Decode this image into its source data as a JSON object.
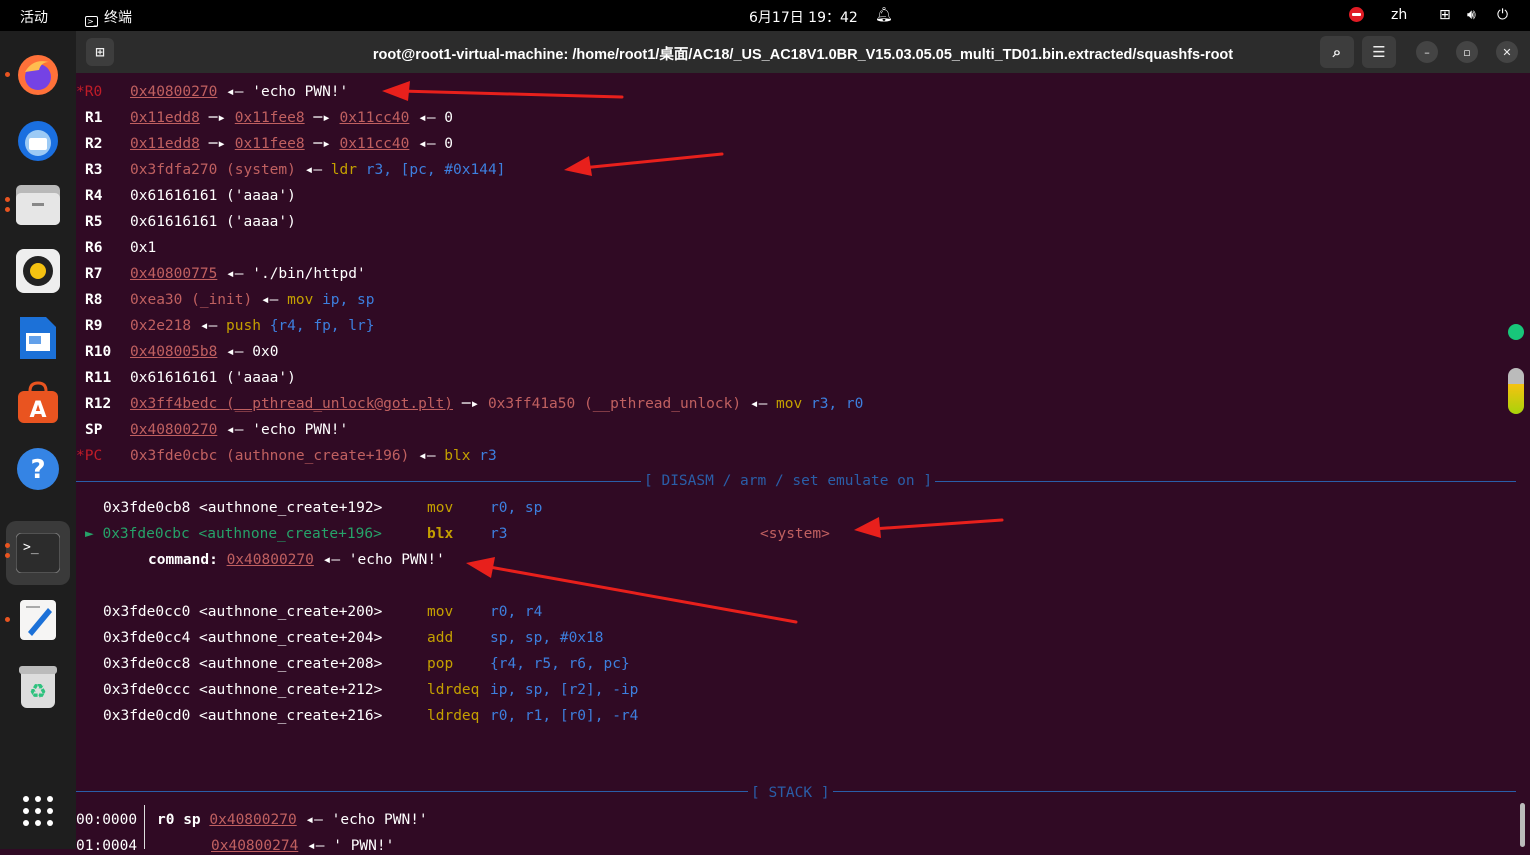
{
  "topbar": {
    "activities": "活动",
    "app": "终端",
    "clock": "6月17日 19：42",
    "lang": "zh"
  },
  "window": {
    "title": "root@root1-virtual-machine: /home/root1/桌面/AC18/_US_AC18V1.0BR_V15.03.05.05_multi_TD01.bin.extracted/squashfs-root"
  },
  "registers": {
    "r0": {
      "name": "*R0",
      "addr": "0x40800270",
      "rest": " ◂— 'echo PWN!'"
    },
    "r1": {
      "name": "R1",
      "a": "0x11edd8",
      "b": "0x11fee8",
      "c": "0x11cc40",
      "tail": "0"
    },
    "r2": {
      "name": "R2",
      "a": "0x11edd8",
      "b": "0x11fee8",
      "c": "0x11cc40",
      "tail": "0"
    },
    "r3": {
      "name": "R3",
      "addr": "0x3fdfa270 (system)",
      "ins": "ldr",
      "ops": "r3, [pc, #0x144]"
    },
    "r4": {
      "name": "R4",
      "val": "0x61616161 ('aaaa')"
    },
    "r5": {
      "name": "R5",
      "val": "0x61616161 ('aaaa')"
    },
    "r6": {
      "name": "R6",
      "val": "0x1"
    },
    "r7": {
      "name": "R7",
      "addr": "0x40800775",
      "rest": " ◂— './bin/httpd'"
    },
    "r8": {
      "name": "R8",
      "addr": "0xea30 (_init)",
      "ins": "mov",
      "ops": "ip, sp"
    },
    "r9": {
      "name": "R9",
      "addr": "0x2e218",
      "ins": "push",
      "ops": "{r4, fp, lr}"
    },
    "r10": {
      "name": "R10",
      "addr": "0x408005b8",
      "rest": " ◂— 0x0"
    },
    "r11": {
      "name": "R11",
      "val": "0x61616161 ('aaaa')"
    },
    "r12": {
      "name": "R12",
      "addr": "0x3ff4bedc (__pthread_unlock@got.plt)",
      "mid": "0x3ff41a50 (__pthread_unlock)",
      "ins": "mov",
      "ops": "r3, r0"
    },
    "sp": {
      "name": "SP",
      "addr": "0x40800270",
      "rest": " ◂— 'echo PWN!'"
    },
    "pc": {
      "name": "*PC",
      "addr": "0x3fde0cbc (authnone_create+196)",
      "ins": "blx",
      "ops": "r3"
    }
  },
  "disasm_header": "[ DISASM / arm / set emulate on ]",
  "disasm": [
    {
      "addr": "0x3fde0cb8 <authnone_create+192>",
      "ins": "mov",
      "ops": "r0, sp"
    },
    {
      "addr": "► 0x3fde0cbc <authnone_create+196>",
      "ins": "blx",
      "ops": "r3",
      "target": "<system>"
    },
    {
      "label": "command:",
      "addr": "0x40800270",
      "rest": " ◂— 'echo PWN!'"
    },
    {
      "addr": "0x3fde0cc0 <authnone_create+200>",
      "ins": "mov",
      "ops": "r0, r4"
    },
    {
      "addr": "0x3fde0cc4 <authnone_create+204>",
      "ins": "add",
      "ops": "sp, sp, #0x18"
    },
    {
      "addr": "0x3fde0cc8 <authnone_create+208>",
      "ins": "pop",
      "ops": "{r4, r5, r6, pc}"
    },
    {
      "addr": "0x3fde0ccc <authnone_create+212>",
      "ins": "ldrdeq",
      "ops": "ip, sp, [r2], -ip"
    },
    {
      "addr": "0x3fde0cd0 <authnone_create+216>",
      "ins": "ldrdeq",
      "ops": "r0, r1, [r0], -r4"
    }
  ],
  "stack_header": "[ STACK ]",
  "stack": [
    {
      "off": "00:0000",
      "regs": "r0 sp",
      "addr": "0x40800270",
      "rest": " ◂— 'echo PWN!'"
    },
    {
      "off": "01:0004",
      "regs": "",
      "addr": "0x40800274",
      "rest": " ◂— ' PWN!'"
    }
  ],
  "colors": {
    "terminal_bg": "#300a24",
    "annotation_arrow": "#e8201c"
  }
}
